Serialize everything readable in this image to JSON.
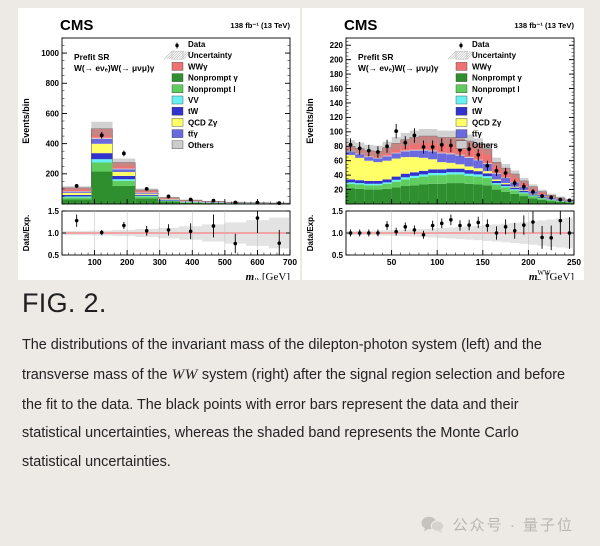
{
  "page": {
    "background": "#edeae5",
    "card_background": "#ffffff"
  },
  "figure": {
    "label": "FIG. 2.",
    "caption_part1": "The distributions of the invariant mass of the dilepton-photon system (left) and the transverse mass of the ",
    "caption_math": "WW",
    "caption_part2": " system (right) after the signal region selection and before the fit to the data. The black points with error bars represent the data and their statistical uncertainties, whereas the shaded band represents the Monte Carlo statistical uncertainties."
  },
  "footer": {
    "watermark_icon": "wechat-bubble-icon",
    "watermark_text": "公众号 · 量子位",
    "watermark_color": "#b9b6b1"
  },
  "legend_entries": [
    {
      "label": "Data",
      "marker": "point",
      "color": "#000000"
    },
    {
      "label": "Uncertainty",
      "marker": "hatch",
      "color": "#b3b3b3"
    },
    {
      "label": "WWγ",
      "marker": "swatch",
      "color": "#ee7272"
    },
    {
      "label": "Nonprompt γ",
      "marker": "swatch",
      "color": "#2f8f2f"
    },
    {
      "label": "Nonprompt l",
      "marker": "swatch",
      "color": "#5fcc5f"
    },
    {
      "label": "VV",
      "marker": "swatch",
      "color": "#66f2f2"
    },
    {
      "label": "tW",
      "marker": "swatch",
      "color": "#3232cc"
    },
    {
      "label": "QCD Zγ",
      "marker": "swatch",
      "color": "#ffff66"
    },
    {
      "label": "tt̅γ",
      "marker": "swatch",
      "color": "#6a6ade"
    },
    {
      "label": "Others",
      "marker": "swatch",
      "color": "#cccccc"
    }
  ],
  "chart_data": [
    {
      "id": "left",
      "type": "bar",
      "stacked": true,
      "title": "CMS",
      "header_right": "138 fb⁻¹ (13 TeV)",
      "annotation_line1": "Prefit SR",
      "annotation_line2": "W(→ eνₑ)W(→ μνμ)γ",
      "xlabel": "m_llγ [GeV]",
      "xlabel_main": "m",
      "xlabel_sub": "llγ",
      "xlabel_tail": "[GeV]",
      "ylabel": "Events/bin",
      "xlim": [
        0,
        700
      ],
      "ylim": [
        0,
        1100
      ],
      "yticks": [
        200,
        400,
        600,
        800,
        1000
      ],
      "xticks": [
        100,
        200,
        300,
        400,
        500,
        600,
        700
      ],
      "grid": false,
      "legend_position": "top-right",
      "bin_edges": [
        0,
        90,
        155,
        225,
        295,
        360,
        430,
        500,
        565,
        635,
        700
      ],
      "series": [
        {
          "name": "Nonprompt γ",
          "color": "#2f8f2f",
          "values": [
            30,
            215,
            120,
            38,
            16,
            9,
            6,
            4,
            3,
            2
          ]
        },
        {
          "name": "Nonprompt l",
          "color": "#5fcc5f",
          "values": [
            14,
            60,
            34,
            12,
            5,
            3,
            2,
            1.5,
            1,
            0.8
          ]
        },
        {
          "name": "VV",
          "color": "#66f2f2",
          "values": [
            6,
            22,
            10,
            4,
            2,
            1.2,
            0.8,
            0.6,
            0.4,
            0.3
          ]
        },
        {
          "name": "tW",
          "color": "#3232cc",
          "values": [
            10,
            40,
            22,
            7,
            3.5,
            2,
            1.4,
            1,
            0.7,
            0.5
          ]
        },
        {
          "name": "QCD Zγ",
          "color": "#ffff66",
          "values": [
            14,
            62,
            26,
            7,
            3,
            1.8,
            1.2,
            0.8,
            0.6,
            0.4
          ]
        },
        {
          "name": "tt̅γ",
          "color": "#6a6ade",
          "values": [
            8,
            32,
            18,
            6,
            3,
            1.8,
            1.2,
            0.8,
            0.6,
            0.4
          ]
        },
        {
          "name": "Others",
          "color": "#cccccc",
          "values": [
            3,
            8,
            5,
            2,
            1,
            0.6,
            0.5,
            0.3,
            0.2,
            0.2
          ]
        },
        {
          "name": "WWγ",
          "color": "#ee7272",
          "values": [
            22,
            60,
            40,
            17,
            9,
            6,
            4,
            3,
            2,
            1.6
          ]
        }
      ],
      "data_points": [
        {
          "x": 45,
          "y": 120,
          "yerr": 12
        },
        {
          "x": 122,
          "y": 455,
          "yerr": 22
        },
        {
          "x": 190,
          "y": 335,
          "yerr": 19
        },
        {
          "x": 260,
          "y": 100,
          "yerr": 11
        },
        {
          "x": 327,
          "y": 50,
          "yerr": 8
        },
        {
          "x": 395,
          "y": 30,
          "yerr": 6
        },
        {
          "x": 465,
          "y": 22,
          "yerr": 5
        },
        {
          "x": 532,
          "y": 10,
          "yerr": 4
        },
        {
          "x": 600,
          "y": 9,
          "yerr": 4
        },
        {
          "x": 667,
          "y": 6,
          "yerr": 3
        }
      ],
      "ratio_panel": {
        "ylabel": "Data/Exp.",
        "ylim": [
          0.5,
          1.5
        ],
        "yticks": [
          0.5,
          1.0,
          1.5
        ],
        "reference": 1.0,
        "reference_color": "#ff6666",
        "points": [
          {
            "x": 45,
            "y": 1.28,
            "yerr": 0.14
          },
          {
            "x": 122,
            "y": 1.01,
            "yerr": 0.06
          },
          {
            "x": 190,
            "y": 1.17,
            "yerr": 0.08
          },
          {
            "x": 260,
            "y": 1.05,
            "yerr": 0.11
          },
          {
            "x": 327,
            "y": 1.07,
            "yerr": 0.13
          },
          {
            "x": 395,
            "y": 1.04,
            "yerr": 0.18
          },
          {
            "x": 465,
            "y": 1.16,
            "yerr": 0.26
          },
          {
            "x": 532,
            "y": 0.76,
            "yerr": 0.22
          },
          {
            "x": 600,
            "y": 1.34,
            "yerr": 0.34
          },
          {
            "x": 667,
            "y": 0.77,
            "yerr": 0.3
          }
        ]
      }
    },
    {
      "id": "right",
      "type": "bar",
      "stacked": true,
      "title": "CMS",
      "header_right": "138 fb⁻¹ (13 TeV)",
      "annotation_line1": "Prefit SR",
      "annotation_line2": "W(→ eνₑ)W(→ μνμ)γ",
      "xlabel": "m_T^WW [GeV]",
      "xlabel_main": "m",
      "xlabel_sub": "T",
      "xlabel_sup": "WW",
      "xlabel_tail": "[GeV]",
      "ylabel": "Events/bin",
      "xlim": [
        0,
        250
      ],
      "ylim": [
        0,
        230
      ],
      "yticks": [
        20,
        40,
        60,
        80,
        100,
        120,
        140,
        160,
        180,
        200,
        220
      ],
      "xticks": [
        50,
        100,
        150,
        200,
        250
      ],
      "grid": false,
      "legend_position": "top-right",
      "bin_edges": [
        0,
        10,
        20,
        30,
        40,
        50,
        60,
        70,
        80,
        90,
        100,
        110,
        120,
        130,
        140,
        150,
        160,
        170,
        180,
        190,
        200,
        210,
        220,
        230,
        240,
        250
      ],
      "series": [
        {
          "name": "Nonprompt γ",
          "color": "#2f8f2f",
          "values": [
            22,
            21,
            20,
            20,
            21,
            23,
            25,
            26,
            27,
            28,
            28,
            29,
            29,
            28,
            27,
            26,
            20,
            17,
            14,
            11,
            8,
            6,
            4,
            3,
            2
          ]
        },
        {
          "name": "Nonprompt l",
          "color": "#5fcc5f",
          "values": [
            6,
            6,
            6,
            6,
            7,
            8,
            9,
            10,
            11,
            12,
            12,
            12,
            12,
            11,
            11,
            10,
            7,
            6,
            5,
            4,
            3,
            2,
            1.5,
            1,
            0.7
          ]
        },
        {
          "name": "VV",
          "color": "#66f2f2",
          "values": [
            2,
            2,
            2,
            2,
            2,
            2.5,
            3,
            3,
            3,
            3,
            3,
            3,
            3,
            3,
            3,
            2.5,
            2,
            1.8,
            1.5,
            1.2,
            0.9,
            0.7,
            0.5,
            0.3,
            0.2
          ]
        },
        {
          "name": "tW",
          "color": "#3232cc",
          "values": [
            4,
            4,
            4,
            4,
            4,
            4.5,
            5,
            5,
            5,
            5,
            5,
            5,
            5,
            5,
            4.5,
            4,
            3,
            2.6,
            2.2,
            1.8,
            1.3,
            1,
            0.7,
            0.5,
            0.3
          ]
        },
        {
          "name": "QCD Zγ",
          "color": "#ffff66",
          "values": [
            34,
            31,
            28,
            26,
            26,
            25,
            23,
            21,
            18,
            14,
            10,
            8,
            6,
            5,
            4,
            3,
            2,
            1.6,
            1.3,
            1,
            0.8,
            0.6,
            0.4,
            0.3,
            0.2
          ]
        },
        {
          "name": "tt̅γ",
          "color": "#6a6ade",
          "values": [
            5,
            5,
            5,
            5,
            6,
            7,
            8,
            9,
            10,
            11,
            12,
            12,
            12,
            12,
            11,
            10,
            8,
            7,
            6,
            4.5,
            3.5,
            2.5,
            1.8,
            1.2,
            0.8
          ]
        },
        {
          "name": "Others",
          "color": "#cccccc",
          "values": [
            1,
            1,
            1,
            1,
            1,
            1,
            1.2,
            1.2,
            1.2,
            1.2,
            1.2,
            1.2,
            1.2,
            1.2,
            1,
            1,
            0.8,
            0.7,
            0.6,
            0.5,
            0.4,
            0.3,
            0.2,
            0.2,
            0.1
          ]
        },
        {
          "name": "WWγ",
          "color": "#ee7272",
          "values": [
            6,
            7,
            8,
            9,
            11,
            13,
            15,
            17,
            19,
            20,
            21,
            22,
            22,
            22,
            21,
            20,
            15,
            13,
            11,
            8,
            6,
            4,
            3,
            2,
            1.2
          ]
        }
      ],
      "data_points": [
        {
          "x": 5,
          "y": 82,
          "yerr": 9
        },
        {
          "x": 15,
          "y": 77,
          "yerr": 9
        },
        {
          "x": 25,
          "y": 74,
          "yerr": 8
        },
        {
          "x": 35,
          "y": 72,
          "yerr": 8
        },
        {
          "x": 45,
          "y": 80,
          "yerr": 9
        },
        {
          "x": 55,
          "y": 101,
          "yerr": 10
        },
        {
          "x": 65,
          "y": 85,
          "yerr": 9
        },
        {
          "x": 75,
          "y": 95,
          "yerr": 10
        },
        {
          "x": 85,
          "y": 79,
          "yerr": 9
        },
        {
          "x": 95,
          "y": 79,
          "yerr": 9
        },
        {
          "x": 105,
          "y": 82,
          "yerr": 9
        },
        {
          "x": 115,
          "y": 81,
          "yerr": 9
        },
        {
          "x": 125,
          "y": 75,
          "yerr": 9
        },
        {
          "x": 135,
          "y": 76,
          "yerr": 9
        },
        {
          "x": 145,
          "y": 68,
          "yerr": 8
        },
        {
          "x": 155,
          "y": 53,
          "yerr": 7
        },
        {
          "x": 165,
          "y": 46,
          "yerr": 7
        },
        {
          "x": 175,
          "y": 43,
          "yerr": 7
        },
        {
          "x": 185,
          "y": 29,
          "yerr": 5
        },
        {
          "x": 195,
          "y": 24,
          "yerr": 5
        },
        {
          "x": 205,
          "y": 17,
          "yerr": 4
        },
        {
          "x": 215,
          "y": 11,
          "yerr": 3
        },
        {
          "x": 225,
          "y": 9,
          "yerr": 3
        },
        {
          "x": 235,
          "y": 6,
          "yerr": 2.5
        },
        {
          "x": 245,
          "y": 5,
          "yerr": 2.5
        }
      ],
      "ratio_panel": {
        "ylabel": "Data/Exp.",
        "ylim": [
          0.5,
          1.5
        ],
        "yticks": [
          0.5,
          1.0,
          1.5
        ],
        "reference": 1.0,
        "reference_color": "#ff6666",
        "points": [
          {
            "x": 5,
            "y": 1.0,
            "yerr": 0.08
          },
          {
            "x": 15,
            "y": 1.0,
            "yerr": 0.08
          },
          {
            "x": 25,
            "y": 1.0,
            "yerr": 0.08
          },
          {
            "x": 35,
            "y": 1.0,
            "yerr": 0.08
          },
          {
            "x": 45,
            "y": 1.17,
            "yerr": 0.1
          },
          {
            "x": 55,
            "y": 1.03,
            "yerr": 0.09
          },
          {
            "x": 65,
            "y": 1.14,
            "yerr": 0.1
          },
          {
            "x": 75,
            "y": 1.07,
            "yerr": 0.1
          },
          {
            "x": 85,
            "y": 0.96,
            "yerr": 0.09
          },
          {
            "x": 95,
            "y": 1.17,
            "yerr": 0.11
          },
          {
            "x": 105,
            "y": 1.22,
            "yerr": 0.11
          },
          {
            "x": 115,
            "y": 1.3,
            "yerr": 0.12
          },
          {
            "x": 125,
            "y": 1.17,
            "yerr": 0.12
          },
          {
            "x": 135,
            "y": 1.18,
            "yerr": 0.12
          },
          {
            "x": 145,
            "y": 1.24,
            "yerr": 0.13
          },
          {
            "x": 155,
            "y": 1.17,
            "yerr": 0.14
          },
          {
            "x": 165,
            "y": 1.0,
            "yerr": 0.15
          },
          {
            "x": 175,
            "y": 1.14,
            "yerr": 0.17
          },
          {
            "x": 185,
            "y": 1.05,
            "yerr": 0.18
          },
          {
            "x": 195,
            "y": 1.18,
            "yerr": 0.22
          },
          {
            "x": 205,
            "y": 1.25,
            "yerr": 0.24
          },
          {
            "x": 215,
            "y": 0.9,
            "yerr": 0.26
          },
          {
            "x": 225,
            "y": 0.89,
            "yerr": 0.28
          },
          {
            "x": 235,
            "y": 1.28,
            "yerr": 0.32
          },
          {
            "x": 245,
            "y": 1.0,
            "yerr": 0.36
          }
        ]
      }
    }
  ]
}
